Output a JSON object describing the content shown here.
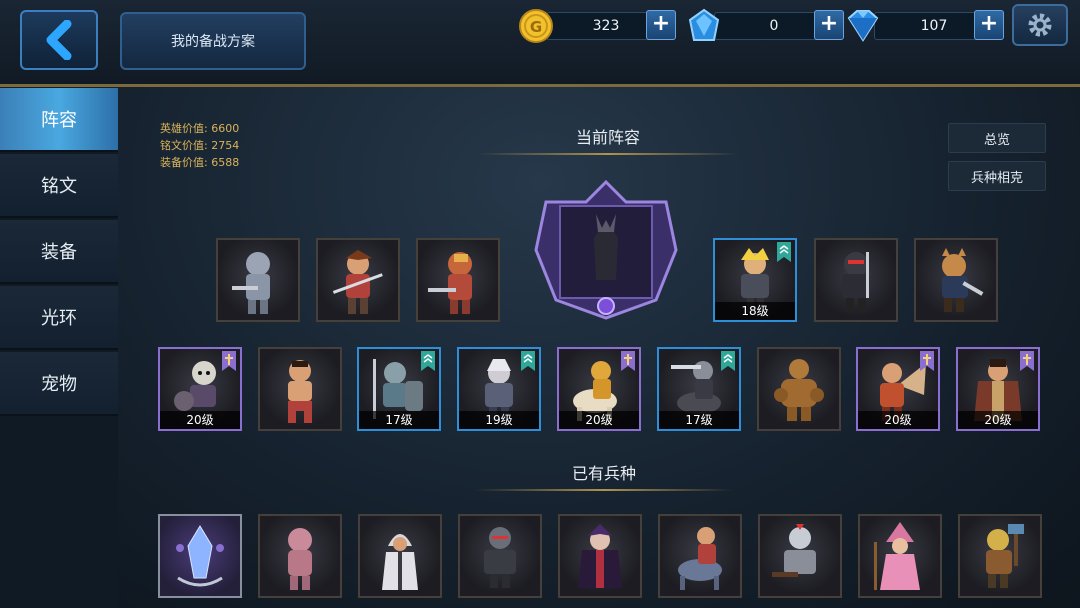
{
  "header": {
    "plan_label": "我的备战方案",
    "resources": [
      {
        "name": "gold",
        "icon": "gold-coin-icon",
        "value": "323"
      },
      {
        "name": "crystal",
        "icon": "blue-crystal-icon",
        "value": "0"
      },
      {
        "name": "diamond",
        "icon": "diamond-icon",
        "value": "107"
      }
    ]
  },
  "sidebar": {
    "tabs": [
      {
        "label": "阵容",
        "active": true
      },
      {
        "label": "铭文",
        "active": false
      },
      {
        "label": "装备",
        "active": false
      },
      {
        "label": "光环",
        "active": false
      },
      {
        "label": "宠物",
        "active": false
      }
    ]
  },
  "stats": [
    {
      "text": "英雄价值: 6600"
    },
    {
      "text": "铭文价值: 2754"
    },
    {
      "text": "装备价值: 6588"
    }
  ],
  "sections": {
    "current_lineup": "当前阵容",
    "owned_units": "已有兵种"
  },
  "buttons": {
    "overview": "总览",
    "counter": "兵种相克"
  },
  "lineup_row1_left": [
    {
      "unit": "silver-knight",
      "level": ""
    },
    {
      "unit": "red-swordsman",
      "level": ""
    },
    {
      "unit": "red-knight",
      "level": ""
    }
  ],
  "lineup_row1_right": [
    {
      "unit": "blonde-warrior",
      "level": "18级",
      "rank": "blue"
    },
    {
      "unit": "ninja",
      "level": ""
    },
    {
      "unit": "fox-swordsman",
      "level": ""
    }
  ],
  "lineup_row2": [
    {
      "unit": "skeleton",
      "level": "20级",
      "rank": "purple"
    },
    {
      "unit": "martial-artist",
      "level": "",
      "rank": ""
    },
    {
      "unit": "shield-spearman",
      "level": "17级",
      "rank": "blue"
    },
    {
      "unit": "white-haired-fighter",
      "level": "19级",
      "rank": "blue"
    },
    {
      "unit": "golden-cavalry",
      "level": "20级",
      "rank": "purple"
    },
    {
      "unit": "dark-knight",
      "level": "17级",
      "rank": "blue"
    },
    {
      "unit": "rock-golem",
      "level": "",
      "rank": ""
    },
    {
      "unit": "winged-warrior",
      "level": "20级",
      "rank": "purple"
    },
    {
      "unit": "robed-lord",
      "level": "20级",
      "rank": "purple"
    }
  ],
  "owned_units": [
    {
      "unit": "crystal-relic",
      "rank": "special"
    },
    {
      "unit": "pink-mummy"
    },
    {
      "unit": "hooded-priest"
    },
    {
      "unit": "armored-berserker"
    },
    {
      "unit": "vampire"
    },
    {
      "unit": "horse-rider"
    },
    {
      "unit": "armored-crossbowman"
    },
    {
      "unit": "pink-witch"
    },
    {
      "unit": "hammer-warrior"
    }
  ],
  "colors": {
    "accent_blue": "#2f8ed8",
    "accent_purple": "#8a6fd0",
    "gold_text": "#d9b35a",
    "divider_gold": "#b0924e"
  }
}
